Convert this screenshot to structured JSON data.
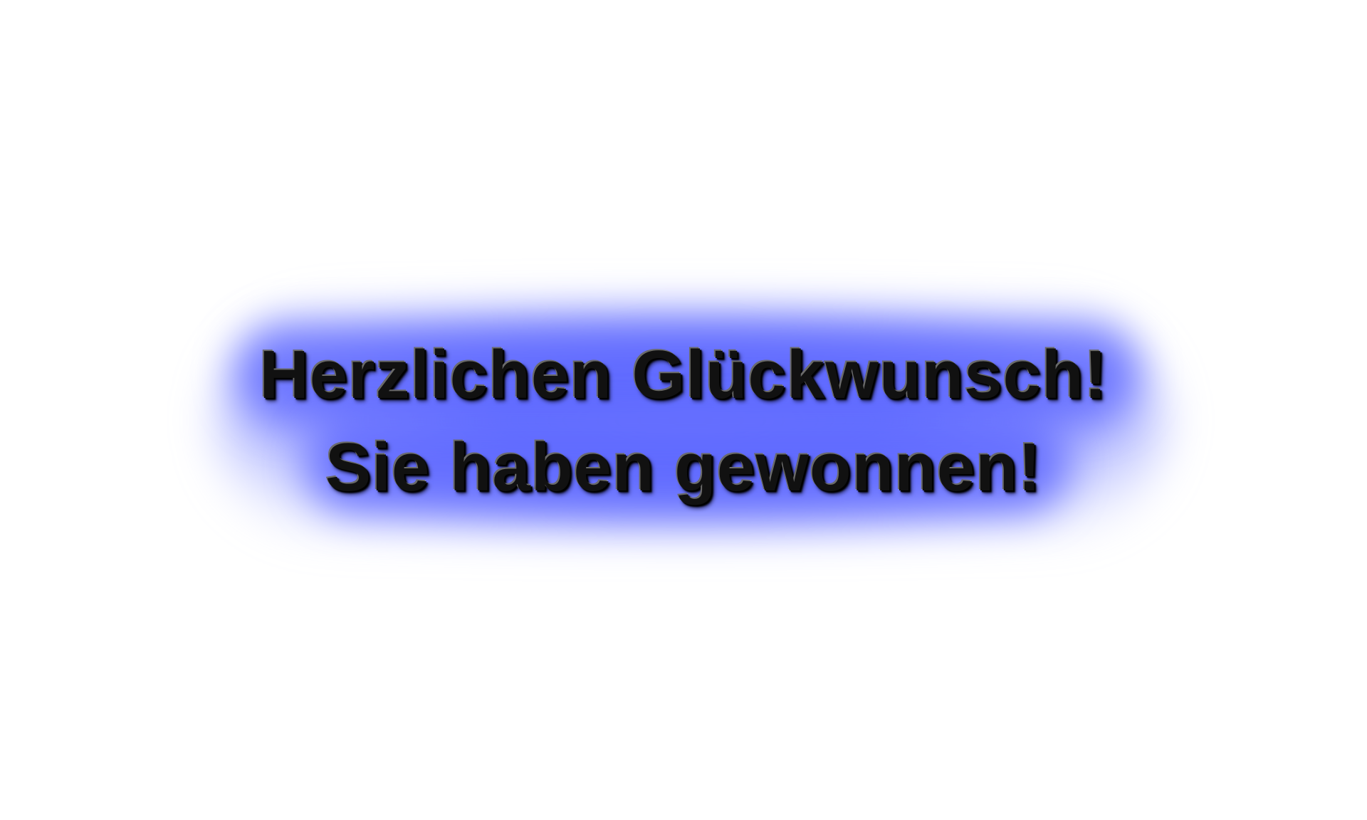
{
  "message": {
    "line1": "Herzlichen Glückwunsch!",
    "line2": "Sie haben gewonnen!"
  },
  "colors": {
    "background": "#ffffff",
    "glow": "#6e78ff",
    "text": "#111111"
  }
}
